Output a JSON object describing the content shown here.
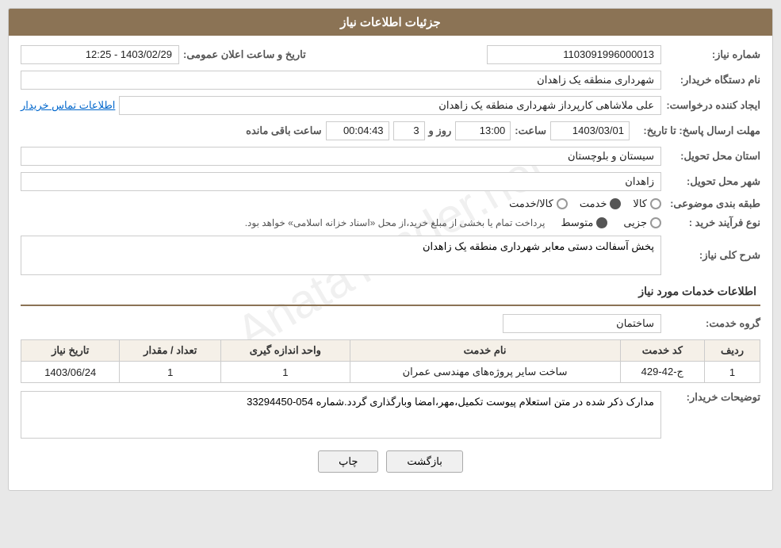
{
  "page": {
    "title": "جزئیات اطلاعات نیاز"
  },
  "fields": {
    "shomara_niaz_label": "شماره نیاز:",
    "shomara_niaz_value": "1103091996000013",
    "nam_dasgah_label": "نام دستگاه خریدار:",
    "nam_dasgah_value": "شهرداری منطقه یک زاهدان",
    "ijad_label": "ایجاد کننده درخواست:",
    "ijad_value": "علی ملاشاهی کارپرداز شهرداری منطقه یک زاهدان",
    "ijad_link": "اطلاعات تماس خریدار",
    "mohlat_label": "مهلت ارسال پاسخ: تا تاریخ:",
    "mohlat_date": "1403/03/01",
    "mohlat_saat_label": "ساعت:",
    "mohlat_saat_value": "13:00",
    "mohlat_roz_label": "روز و",
    "mohlat_roz_value": "3",
    "mohlat_baqi_label": "ساعت باقی مانده",
    "mohlat_baqi_value": "00:04:43",
    "tarix_elan_label": "تاریخ و ساعت اعلان عمومی:",
    "tarix_elan_value": "1403/02/29 - 12:25",
    "ostan_label": "استان محل تحویل:",
    "ostan_value": "سیستان و بلوچستان",
    "shahr_label": "شهر محل تحویل:",
    "shahr_value": "زاهدان",
    "tabagheh_label": "طبقه بندی موضوعی:",
    "radio_kala": "کالا",
    "radio_khedmat": "خدمت",
    "radio_kala_khedmat": "کالا/خدمت",
    "noeh_label": "نوع فرآیند خرید :",
    "radio_jezii": "جزیی",
    "radio_motosat": "متوسط",
    "noeh_description": "پرداخت تمام یا بخشی از مبلغ خرید،از محل «اسناد خزانه اسلامی» خواهد بود.",
    "sharh_label": "شرح کلی نیاز:",
    "sharh_value": "پخش آسفالت دستی معابر شهرداری منطقه یک زاهدان",
    "section_khadamat": "اطلاعات خدمات مورد نیاز",
    "grohe_khedmat_label": "گروه خدمت:",
    "grohe_khedmat_value": "ساختمان",
    "table": {
      "headers": [
        "ردیف",
        "کد خدمت",
        "نام خدمت",
        "واحد اندازه گیری",
        "تعداد / مقدار",
        "تاریخ نیاز"
      ],
      "rows": [
        [
          "1",
          "ج-42-429",
          "ساخت سایر پروژه‌های مهندسی عمران",
          "1",
          "1",
          "1403/06/24"
        ]
      ]
    },
    "tozi_label": "توضیحات خریدار:",
    "tozi_value": "مدارک ذکر شده در متن استعلام پیوست تکمیل،مهر،امضا وبارگذاری گردد.شماره 054-33294450",
    "btn_print": "چاپ",
    "btn_back": "بازگشت"
  }
}
